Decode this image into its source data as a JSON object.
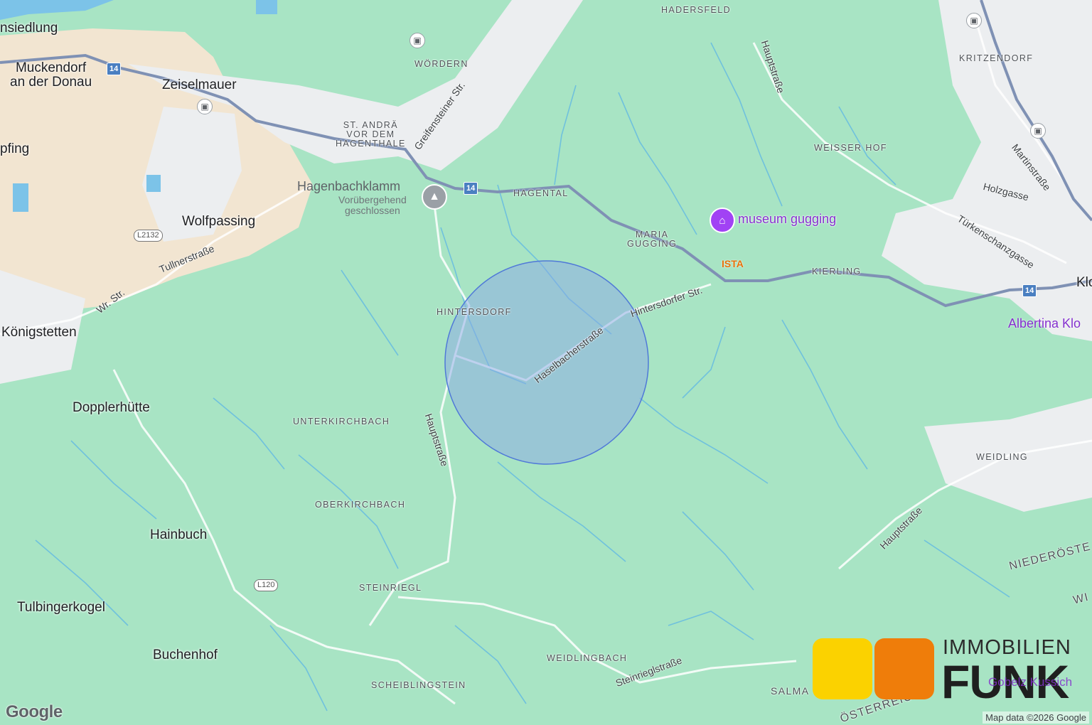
{
  "map": {
    "colors": {
      "forest": "#a8e4c4",
      "urban": "#eceef0",
      "farmland": "#f3e6d2",
      "water": "#7cc3e8",
      "highway": "#7f91b4",
      "stream": "#6fc1dd",
      "circle_fill": "#8aa8e6",
      "circle_stroke": "#4f78d8"
    },
    "places": {
      "ansiedlung": "nsiedlung",
      "muckendorf": "Muckendorf\nan der Donau",
      "zeiselmauer": "Zeiselmauer",
      "wolfpassing": "Wolfpassing",
      "pfing": "pfing",
      "koenigstetten": "Königstetten",
      "dopplerhuette": "Dopplerhütte",
      "hainbuch": "Hainbuch",
      "tulbingerkogel": "Tulbingerkogel",
      "buchenhof": "Buchenhof",
      "woerdern": "WÖRDERN",
      "st_andrae": "ST. ANDRÄ\nVOR DEM\nHAGENTHALE",
      "hadersfeld": "HADERSFELD",
      "kritzendorf": "KRITZENDORF",
      "weisser_hof": "WEISSER HOF",
      "hagental": "HAGENTAL",
      "maria_gugging": "MARIA\nGUGGING",
      "kierling": "KIERLING",
      "hintersdorf": "HINTERSDORF",
      "unterkirchbach": "UNTERKIRCHBACH",
      "oberkirchbach": "OBERKIRCHBACH",
      "steinriegl": "STEINRIEGL",
      "weidlingbach": "WEIDLINGBACH",
      "scheiblingstein": "SCHEIBLINGSTEIN",
      "weidling": "WEIDLING",
      "salma": "SALMA",
      "klo": "Klo",
      "niederoest": "NIEDERÖSTE",
      "wi": "WI",
      "oesterreic": "ÖSTERREICH"
    },
    "streets": {
      "greifensteiner": "Greifensteiner Str.",
      "tullnerstrasse": "Tullnerstraße",
      "wr_str": "Wr. Str.",
      "hauptstrasse_n": "Hauptstraße",
      "hauptstrasse_s": "Hauptstraße",
      "hauptstrasse_e": "Hauptstraße",
      "hintersdorfer": "Hintersdorfer Str.",
      "haselbacher": "Haselbacherstraße",
      "martinstrasse": "Martinstraße",
      "holzgasse": "Holzgasse",
      "tuerkenschanz": "Türkenschanzgasse",
      "steinrieglstrasse": "Steinrieglstraße"
    },
    "shields": {
      "b14_a": "14",
      "b14_b": "14",
      "b14_c": "14",
      "l2132": "L2132",
      "l120": "L120"
    },
    "pois": {
      "hagenbachklamm": "Hagenbachklamm",
      "hagenbachklamm_status": "Vorübergehend\ngeschlossen",
      "museum": "museum gugging",
      "ista": "ISTA",
      "albertina": "Albertina Klo",
      "gobelz": "Gobelz Kussich"
    },
    "google_logo": "Google",
    "attribution": "Map data ©2026 Google"
  },
  "brand": {
    "line1": "IMMOBILIEN",
    "line2": "FUNK",
    "yellow": "#fbd200",
    "orange": "#ef7d0a"
  }
}
